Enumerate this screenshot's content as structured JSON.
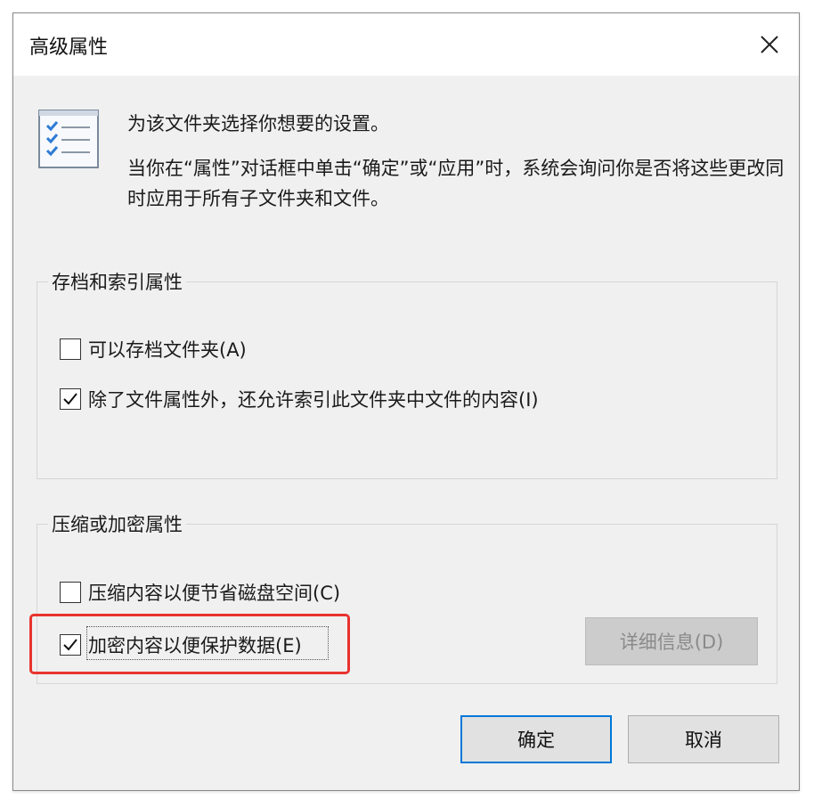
{
  "window": {
    "title": "高级属性"
  },
  "info": {
    "line1": "为该文件夹选择你想要的设置。",
    "line2": "当你在“属性”对话框中单击“确定”或“应用”时，系统会询问你是否将这些更改同时应用于所有子文件夹和文件。"
  },
  "archive_group": {
    "label": "存档和索引属性",
    "options": [
      {
        "label": "可以存档文件夹(A)",
        "checked": false
      },
      {
        "label": "除了文件属性外，还允许索引此文件夹中文件的内容(I)",
        "checked": true
      }
    ]
  },
  "compress_group": {
    "label": "压缩或加密属性",
    "options": [
      {
        "label": "压缩内容以便节省磁盘空间(C)",
        "checked": false
      },
      {
        "label": "加密内容以便保护数据(E)",
        "checked": true
      }
    ],
    "details_button": "详细信息(D)"
  },
  "buttons": {
    "ok": "确定",
    "cancel": "取消"
  },
  "icons": [
    "close-icon",
    "checklist-icon",
    "checkmark-icon"
  ],
  "colors": {
    "dialog_bg": "#f0f0f0",
    "accent_border": "#0078d7",
    "annotation_red": "#e8332f",
    "disabled_button": "#cccccc"
  }
}
